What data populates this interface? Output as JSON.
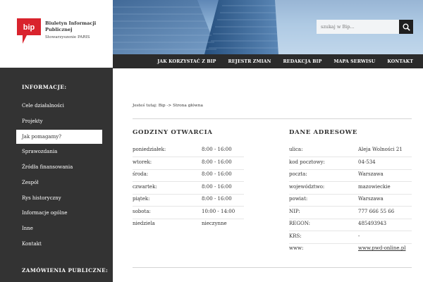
{
  "brand": {
    "logo_text": "bip",
    "title": "Biuletyn Informacji Publicznej",
    "subtitle": "Stowarzyszenie PARIS",
    "accent": "#d9232d"
  },
  "search": {
    "placeholder": "szukaj w Bip..."
  },
  "nav": {
    "items": [
      "JAK KORZYSTAĆ Z BIP",
      "REJESTR ZMIAN",
      "REDAKCJA BIP",
      "MAPA SERWISU",
      "KONTAKT"
    ]
  },
  "sidebar": {
    "heading": "INFORMACJE:",
    "items": [
      {
        "label": "Cele działalności"
      },
      {
        "label": "Projekty"
      },
      {
        "label": "Jak pomagamy?"
      },
      {
        "label": "Sprawozdania"
      },
      {
        "label": "Źródła finansowania"
      },
      {
        "label": "Zespół"
      },
      {
        "label": "Rys historyczny"
      },
      {
        "label": "Informacje ogólne"
      },
      {
        "label": "Inne"
      },
      {
        "label": "Kontakt"
      }
    ],
    "active_label": "Jak pomagamy?",
    "heading2": "ZAMÓWIENIA PUBLICZNE:"
  },
  "breadcrumb": {
    "prefix": "Jesteś tutaj:",
    "home": "Bip",
    "sep": "->",
    "current": "Strona główna"
  },
  "hours": {
    "title": "GODZINY OTWARCIA",
    "rows": [
      {
        "day": "poniedziałek:",
        "hours": "8:00 - 16:00"
      },
      {
        "day": "wtorek:",
        "hours": "8:00 - 16:00"
      },
      {
        "day": "środa:",
        "hours": "8:00 - 16:00"
      },
      {
        "day": "czwartek:",
        "hours": "8:00 - 16:00"
      },
      {
        "day": "piątek:",
        "hours": "8:00 - 16:00"
      },
      {
        "day": "sobota:",
        "hours": "10:00 - 14:00"
      },
      {
        "day": "niedziela",
        "hours": "nieczynne"
      }
    ]
  },
  "address": {
    "title": "DANE ADRESOWE",
    "rows": [
      {
        "label": "ulica:",
        "value": "Aleja Wolności 21"
      },
      {
        "label": "kod pocztowy:",
        "value": "04-534"
      },
      {
        "label": "poczta:",
        "value": "Warszawa"
      },
      {
        "label": "województwo:",
        "value": "mazowieckie"
      },
      {
        "label": "powiat:",
        "value": "Warszawa"
      },
      {
        "label": "NIP:",
        "value": "777 666 55 66"
      },
      {
        "label": "REGON:",
        "value": "485493943"
      },
      {
        "label": "KRS:",
        "value": "-"
      },
      {
        "label": "www:",
        "value": "www.pwd-online.pl"
      }
    ]
  }
}
